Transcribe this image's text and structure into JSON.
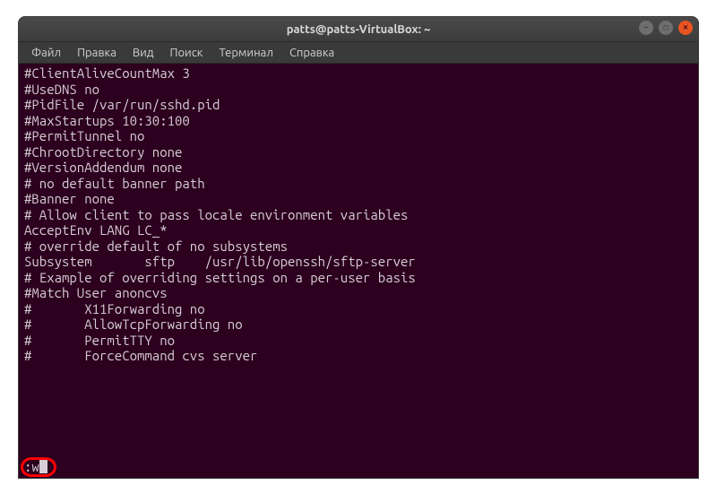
{
  "window": {
    "title": "patts@patts-VirtualBox: ~"
  },
  "menu": {
    "file": "Файл",
    "edit": "Правка",
    "view": "Вид",
    "search": "Поиск",
    "terminal": "Терминал",
    "help": "Справка"
  },
  "content": {
    "lines": [
      "#ClientAliveCountMax 3",
      "#UseDNS no",
      "#PidFile /var/run/sshd.pid",
      "#MaxStartups 10:30:100",
      "#PermitTunnel no",
      "#ChrootDirectory none",
      "#VersionAddendum none",
      "",
      "# no default banner path",
      "#Banner none",
      "",
      "# Allow client to pass locale environment variables",
      "AcceptEnv LANG LC_*",
      "",
      "# override default of no subsystems",
      "Subsystem       sftp    /usr/lib/openssh/sftp-server",
      "",
      "# Example of overriding settings on a per-user basis",
      "#Match User anoncvs",
      "#       X11Forwarding no",
      "#       AllowTcpForwarding no",
      "#       PermitTTY no",
      "#       ForceCommand cvs server"
    ]
  },
  "command": {
    "text": ":w"
  }
}
